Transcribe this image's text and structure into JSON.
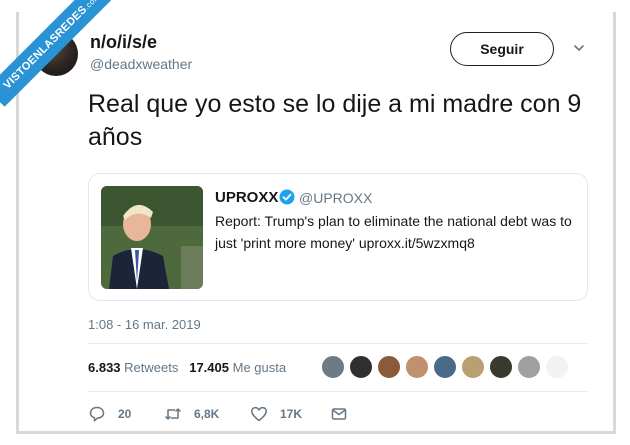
{
  "watermark": {
    "main": "VISTOENLASREDES",
    "suffix": ".com"
  },
  "author": {
    "display_name": "n/o/i/s/e",
    "handle": "@deadxweather",
    "avatar_icon": "avatar-icon"
  },
  "follow_button": {
    "label": "Seguir"
  },
  "tweet": {
    "text": "Real que yo esto se lo dije a mi madre con 9 años"
  },
  "quoted_tweet": {
    "name": "UPROXX",
    "handle": "@UPROXX",
    "verified": true,
    "text": "Report: Trump's plan to eliminate the national debt was to just 'print more money' uproxx.it/5wzxmq8",
    "photo_icon": "news-photo"
  },
  "timestamp": "1:08 - 16 mar. 2019",
  "stats": {
    "retweets_count": "6.833",
    "retweets_label": "Retweets",
    "likes_count": "17.405",
    "likes_label": "Me gusta"
  },
  "likers": [
    {
      "color": "#6d7b86"
    },
    {
      "color": "#2f2f2f"
    },
    {
      "color": "#8a5a3a"
    },
    {
      "color": "#c09070"
    },
    {
      "color": "#4a6a8a"
    },
    {
      "color": "#b8a070"
    },
    {
      "color": "#3a3a2e"
    },
    {
      "color": "#a0a0a0"
    },
    {
      "color": "#f2f2f2"
    }
  ],
  "actions": {
    "reply_count": "20",
    "retweet_count": "6,8K",
    "like_count": "17K"
  },
  "colors": {
    "accent": "#1da1f2",
    "text_secondary": "#657786",
    "border": "#e1e8ed"
  }
}
